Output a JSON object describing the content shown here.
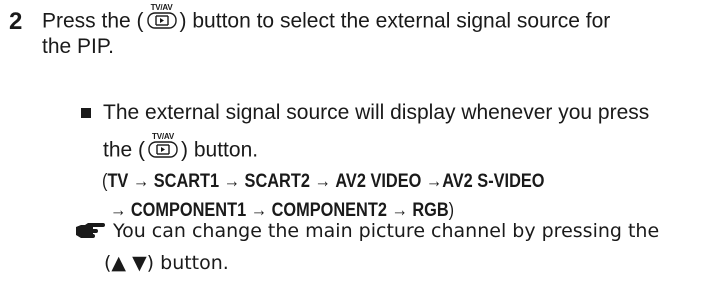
{
  "step": {
    "number": "2",
    "line1_pre": "Press the (",
    "button_label": "TV/AV",
    "line1_post": ") button to select the external signal source for",
    "line2": "the PIP."
  },
  "bullet": {
    "line1": "The external signal source will display whenever you press",
    "line2_pre": "the (",
    "button_label": "TV/AV",
    "line2_post": ") button."
  },
  "sequence": {
    "open": "(",
    "items": [
      "TV",
      "SCART1",
      "SCART2",
      "AV2 VIDEO",
      "AV2 S-VIDEO",
      "COMPONENT1",
      "COMPONENT2",
      "RGB"
    ],
    "arrow": "→",
    "close": ")"
  },
  "note": {
    "line1": "You can change the main picture channel by pressing the",
    "line2": "(▲ ▼) button."
  }
}
